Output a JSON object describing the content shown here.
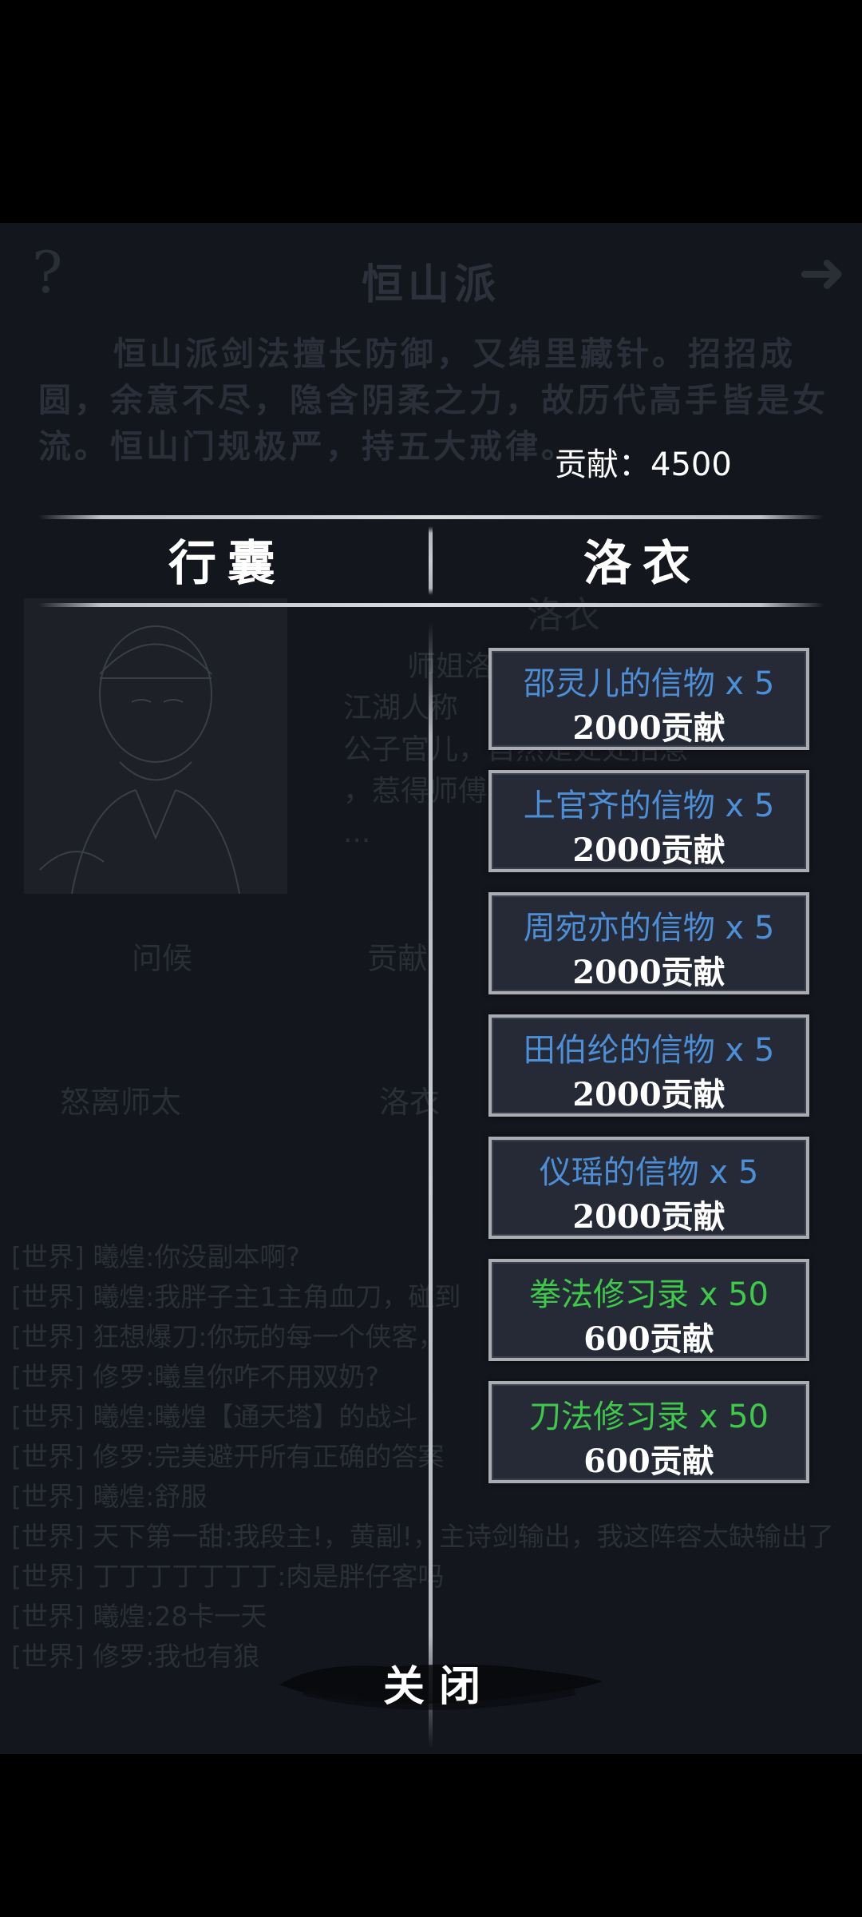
{
  "background": {
    "help_glyph": "?",
    "arrow_glyph": "➜",
    "sect_title": "恒山派",
    "sect_desc": "恒山派剑法擅长防御，又绵里藏针。招招成圆，余意不尽，隐含阴柔之力，故历代高手皆是女流。恒山门规极严，持五大戒律。",
    "npc_name": "洛衣",
    "npc_text": [
      "师姐洛",
      "江湖人称",
      "公子官儿，自然是处处招惹",
      "，惹得师傅",
      "..."
    ],
    "label_1": "问候",
    "label_2": "贡献",
    "label_3": "怒离师太",
    "label_4": "洛衣",
    "chat": [
      "[世界] 曦煌:你没副本啊?",
      "[世界] 曦煌:我胖子主1主角血刀，碰到",
      "[世界] 狂想爆刀:你玩的每一个侠客，",
      "[世界] 修罗:曦皇你咋不用双奶?",
      "[世界] 曦煌:曦煌【通天塔】的战斗",
      "[世界] 修罗:完美避开所有正确的答案",
      "[世界] 曦煌:舒服",
      "[世界] 天下第一甜:我段主!，黄副!，主诗剑输出，我这阵容太缺输出了",
      "[世界] 丁丁丁丁丁丁丁:肉是胖仔客吗",
      "[世界] 曦煌:28卡一天",
      "[世界] 修罗:我也有狼"
    ]
  },
  "modal": {
    "contribution_text": "贡献：4500",
    "left_header": "行囊",
    "right_header": "洛衣",
    "items": [
      {
        "name": "邵灵儿的信物 x 5",
        "price": "2000贡献",
        "color": "#4d8fd6"
      },
      {
        "name": "上官齐的信物 x 5",
        "price": "2000贡献",
        "color": "#4d8fd6"
      },
      {
        "name": "周宛亦的信物 x 5",
        "price": "2000贡献",
        "color": "#4d8fd6"
      },
      {
        "name": "田伯纶的信物 x 5",
        "price": "2000贡献",
        "color": "#4d8fd6"
      },
      {
        "name": "仪瑶的信物 x 5",
        "price": "2000贡献",
        "color": "#4d8fd6"
      },
      {
        "name": "拳法修习录 x 50",
        "price": "600贡献",
        "color": "#3fc94a"
      },
      {
        "name": "刀法修习录 x 50",
        "price": "600贡献",
        "color": "#3fc94a"
      }
    ],
    "close_label": "关闭"
  }
}
